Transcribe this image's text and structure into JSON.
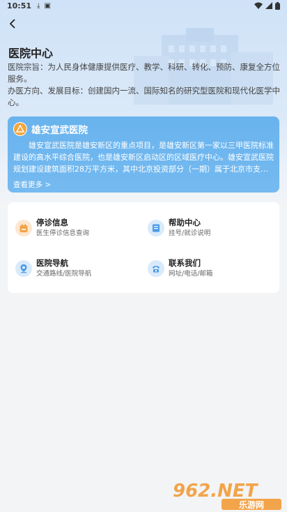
{
  "status_bar": {
    "time": "10:51"
  },
  "page": {
    "title": "医院中心"
  },
  "intro": {
    "mission": "医院宗旨：为人民身体健康提供医疗、教学、科研、转化、预防、康复全方位服务。",
    "goal": "办医方向、发展目标：创建国内一流、国际知名的研究型医院和现代化医学中心。"
  },
  "hospital": {
    "name": "雄安宣武医院",
    "description": "雄安宣武医院是雄安新区的重点项目，是雄安新区第一家以三甲医院标准建设的高水平综合医院，也是雄安新区启动区的区域医疗中心。雄安宣武医院规划建设建筑面积28万平方米，其中北京投资部分（一期）属于北京市支持雄安新区建设的重点项目。",
    "see_more": "查看更多 >"
  },
  "services": [
    {
      "title": "停诊信息",
      "subtitle": "医生停诊信息查询",
      "icon": "calendar-icon"
    },
    {
      "title": "帮助中心",
      "subtitle": "挂号/就诊说明",
      "icon": "help-book-icon"
    },
    {
      "title": "医院导航",
      "subtitle": "交通路线/医院导航",
      "icon": "location-pin-icon"
    },
    {
      "title": "联系我们",
      "subtitle": "网址/电话/邮箱",
      "icon": "phone-icon"
    }
  ],
  "watermark": {
    "brand": "962.NET",
    "site": "乐游网"
  },
  "colors": {
    "accent": "#6fb6ee",
    "orange": "#f2a44a",
    "blue_icon": "#4d9be6"
  }
}
